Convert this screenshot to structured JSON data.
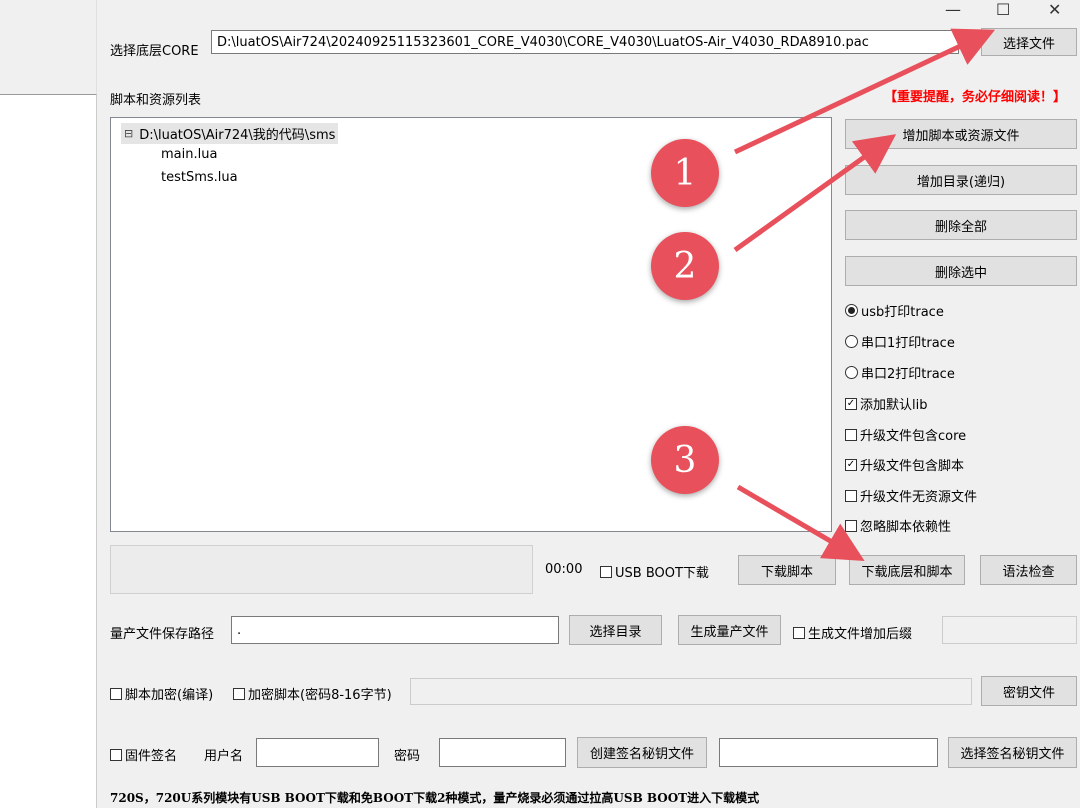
{
  "window": {
    "minimize_glyph": "—",
    "maximize_glyph": "☐",
    "close_glyph": "✕"
  },
  "core": {
    "label": "选择底层CORE",
    "path": "D:\\luatOS\\Air724\\20240925115323601_CORE_V4030\\CORE_V4030\\LuatOS-Air_V4030_RDA8910.pac",
    "select_button": "选择文件"
  },
  "scripts": {
    "label": "脚本和资源列表",
    "warning": "【重要提醒，务必仔细阅读！】",
    "tree": {
      "root": "D:\\luatOS\\Air724\\我的代码\\sms",
      "children": [
        "main.lua",
        "testSms.lua"
      ]
    }
  },
  "actions": {
    "add_file": "增加脚本或资源文件",
    "add_dir": "增加目录(递归)",
    "delete_all": "删除全部",
    "delete_selected": "删除选中"
  },
  "options": {
    "trace": [
      {
        "label": "usb打印trace",
        "selected": true
      },
      {
        "label": "串口1打印trace",
        "selected": false
      },
      {
        "label": "串口2打印trace",
        "selected": false
      }
    ],
    "checks": [
      {
        "label": "添加默认lib",
        "checked": true
      },
      {
        "label": "升级文件包含core",
        "checked": false
      },
      {
        "label": "升级文件包含脚本",
        "checked": true
      },
      {
        "label": "升级文件无资源文件",
        "checked": false
      },
      {
        "label": "忽略脚本依赖性",
        "checked": false
      }
    ]
  },
  "download": {
    "timer": "00:00",
    "usb_boot_label": "USB BOOT下载",
    "download_script": "下载脚本",
    "download_core_and_script": "下载底层和脚本",
    "syntax_check": "语法检查"
  },
  "mass_production": {
    "label": "量产文件保存路径",
    "path": ".",
    "select_dir": "选择目录",
    "generate": "生成量产文件",
    "suffix_label": "生成文件增加后缀"
  },
  "encryption": {
    "compile_label": "脚本加密(编译)",
    "encrypt_label": "加密脚本(密码8-16字节)",
    "key_file": "密钥文件"
  },
  "signing": {
    "firmware_sign_label": "固件签名",
    "username_label": "用户名",
    "password_label": "密码",
    "create_key": "创建签名秘钥文件",
    "select_key": "选择签名秘钥文件"
  },
  "footer_note": "720S，720U系列模块有USB BOOT下载和免BOOT下载2种模式，量产烧录必须通过拉高USB BOOT进入下载模式",
  "annotations": [
    "1",
    "2",
    "3"
  ],
  "colors": {
    "annotation": "#e8505b",
    "warning": "#ff0000"
  }
}
